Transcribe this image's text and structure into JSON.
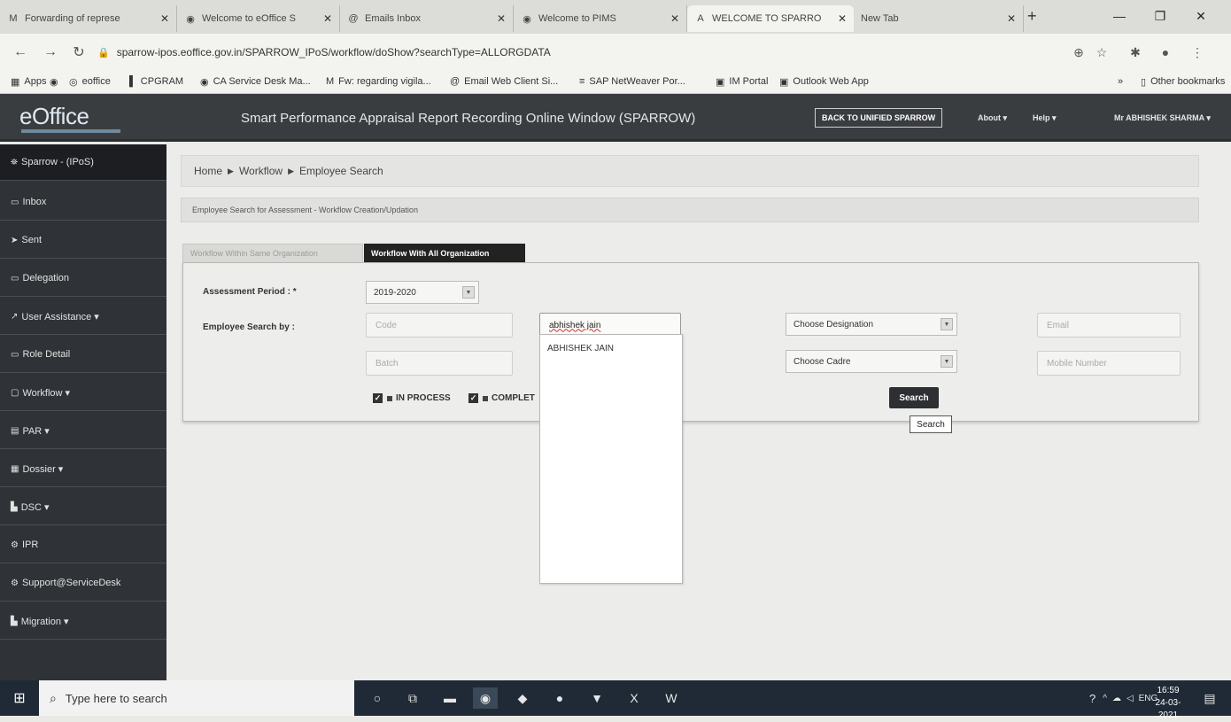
{
  "browser": {
    "tabs": [
      {
        "icon": "M",
        "label": "Forwarding of represe",
        "active": false
      },
      {
        "icon": "◉",
        "label": "Welcome to eOffice S",
        "active": false
      },
      {
        "icon": "@",
        "label": "Emails Inbox",
        "active": false
      },
      {
        "icon": "◉",
        "label": "Welcome to PIMS",
        "active": false
      },
      {
        "icon": "A",
        "label": "WELCOME TO SPARRO",
        "active": true
      },
      {
        "icon": "",
        "label": "New Tab",
        "active": false
      }
    ],
    "new_tab_symbol": "+",
    "url": "sparrow-ipos.eoffice.gov.in/SPARROW_IPoS/workflow/doShow?searchType=ALLORGDATA",
    "bookmarks": [
      {
        "icon": "▦",
        "label": "Apps"
      },
      {
        "icon": "◉",
        "label": ""
      },
      {
        "icon": "◎",
        "label": "eoffice"
      },
      {
        "icon": "▌",
        "label": "CPGRAM"
      },
      {
        "icon": "◉",
        "label": "CA Service Desk Ma..."
      },
      {
        "icon": "M",
        "label": "Fw: regarding vigila..."
      },
      {
        "icon": "@",
        "label": "Email Web Client Si..."
      },
      {
        "icon": "≡",
        "label": "SAP NetWeaver Por..."
      },
      {
        "icon": "▣",
        "label": "IM Portal"
      },
      {
        "icon": "▣",
        "label": "Outlook Web App"
      }
    ],
    "more_bookmarks": "»",
    "other_bookmarks": "Other bookmarks"
  },
  "header": {
    "logo": "eOffice",
    "title": "Smart Performance Appraisal Report Recording Online Window (SPARROW)",
    "back_button": "BACK TO UNIFIED SPARROW",
    "about": "About ▾",
    "help": "Help ▾",
    "user": "Mr ABHISHEK SHARMA ▾"
  },
  "sidebar": {
    "items": [
      {
        "icon": "⛯",
        "label": "Sparrow - (IPoS)"
      },
      {
        "icon": "▭",
        "label": "Inbox"
      },
      {
        "icon": "➤",
        "label": "Sent"
      },
      {
        "icon": "▭",
        "label": "Delegation"
      },
      {
        "icon": "↗",
        "label": "User Assistance ▾"
      },
      {
        "icon": "▭",
        "label": "Role Detail"
      },
      {
        "icon": "▢",
        "label": "Workflow ▾"
      },
      {
        "icon": "▤",
        "label": "PAR ▾"
      },
      {
        "icon": "▦",
        "label": "Dossier ▾"
      },
      {
        "icon": "▙",
        "label": "DSC ▾"
      },
      {
        "icon": "⚙",
        "label": "IPR"
      },
      {
        "icon": "⚙",
        "label": "Support@ServiceDesk"
      },
      {
        "icon": "▙",
        "label": "Migration ▾"
      }
    ]
  },
  "breadcrumb": {
    "home": "Home",
    "sep": "▶",
    "workflow": "Workflow",
    "current": "Employee Search"
  },
  "subtitle": "Employee Search for Assessment - Workflow Creation/Updation",
  "tabs": {
    "same_org": "Workflow Within Same Organization",
    "all_org": "Workflow With All Organization"
  },
  "form": {
    "assessment_label": "Assessment Period : *",
    "assessment_value": "2019-2020",
    "search_by_label": "Employee Search by :",
    "code_placeholder": "Code",
    "batch_placeholder": "Batch",
    "name_value": "abhishek jain",
    "designation_select": "Choose Designation",
    "cadre_select": "Choose Cadre",
    "email_placeholder": "Email",
    "mobile_placeholder": "Mobile Number",
    "in_process": "IN PROCESS",
    "completed": "COMPLET",
    "search_button": "Search",
    "search_tooltip": "Search",
    "suggestions": [
      "ABHISHEK JAIN"
    ]
  },
  "taskbar": {
    "search_placeholder": "Type here to search",
    "lang": "ENG",
    "time": "16:59",
    "date": "24-03-2021"
  }
}
